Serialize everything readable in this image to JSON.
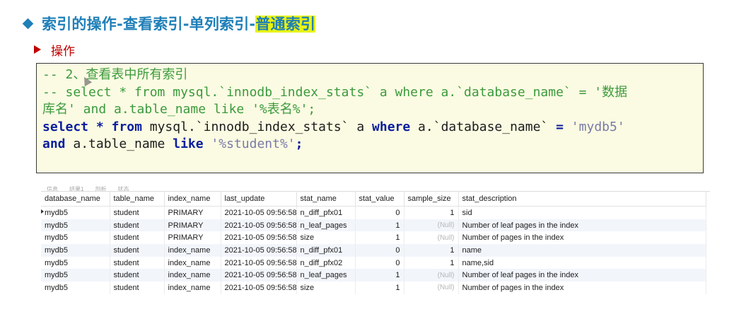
{
  "slide": {
    "title_main": "索引的操作-查看索引-单列索引-",
    "title_highlight": "普通索引",
    "subtitle": "操作"
  },
  "code": {
    "line1": "-- 2、查看表中所有索引",
    "line2": "-- select * from mysql.`innodb_index_stats` a where a.`database_name` = '数据",
    "line3": "库名' and a.table_name like '%表名%';",
    "l4_kw1": "select",
    "l4_kw2": "*",
    "l4_kw3": "from",
    "l4_t1": " mysql.`innodb_index_stats` a ",
    "l4_kw4": "where",
    "l4_t2": " a.`database_name` ",
    "l4_op": "=",
    "l4_str": " 'mydb5'",
    "l5_kw1": "and",
    "l5_t1": " a.table_name ",
    "l5_kw2": "like",
    "l5_str": " '%student%'",
    "l5_end": ";"
  },
  "grid": {
    "tabs": [
      "信息",
      "结果1",
      "剖析",
      "状态"
    ],
    "columns": [
      "database_name",
      "table_name",
      "index_name",
      "last_update",
      "stat_name",
      "stat_value",
      "sample_size",
      "stat_description"
    ],
    "rows": [
      [
        "mydb5",
        "student",
        "PRIMARY",
        "2021-10-05 09:56:58",
        "n_diff_pfx01",
        "0",
        "1",
        "sid"
      ],
      [
        "mydb5",
        "student",
        "PRIMARY",
        "2021-10-05 09:56:58",
        "n_leaf_pages",
        "1",
        "(Null)",
        "Number of leaf pages in the index"
      ],
      [
        "mydb5",
        "student",
        "PRIMARY",
        "2021-10-05 09:56:58",
        "size",
        "1",
        "(Null)",
        "Number of pages in the index"
      ],
      [
        "mydb5",
        "student",
        "index_name",
        "2021-10-05 09:56:58",
        "n_diff_pfx01",
        "0",
        "1",
        "name"
      ],
      [
        "mydb5",
        "student",
        "index_name",
        "2021-10-05 09:56:58",
        "n_diff_pfx02",
        "0",
        "1",
        "name,sid"
      ],
      [
        "mydb5",
        "student",
        "index_name",
        "2021-10-05 09:56:58",
        "n_leaf_pages",
        "1",
        "(Null)",
        "Number of leaf pages in the index"
      ],
      [
        "mydb5",
        "student",
        "index_name",
        "2021-10-05 09:56:58",
        "size",
        "1",
        "(Null)",
        "Number of pages in the index"
      ]
    ]
  },
  "colors": {
    "title": "#1f7fb8",
    "highlight": "#e8f312",
    "subtitle": "#c00000",
    "comment": "#3c9a3c",
    "keyword": "#0a1e9e"
  }
}
